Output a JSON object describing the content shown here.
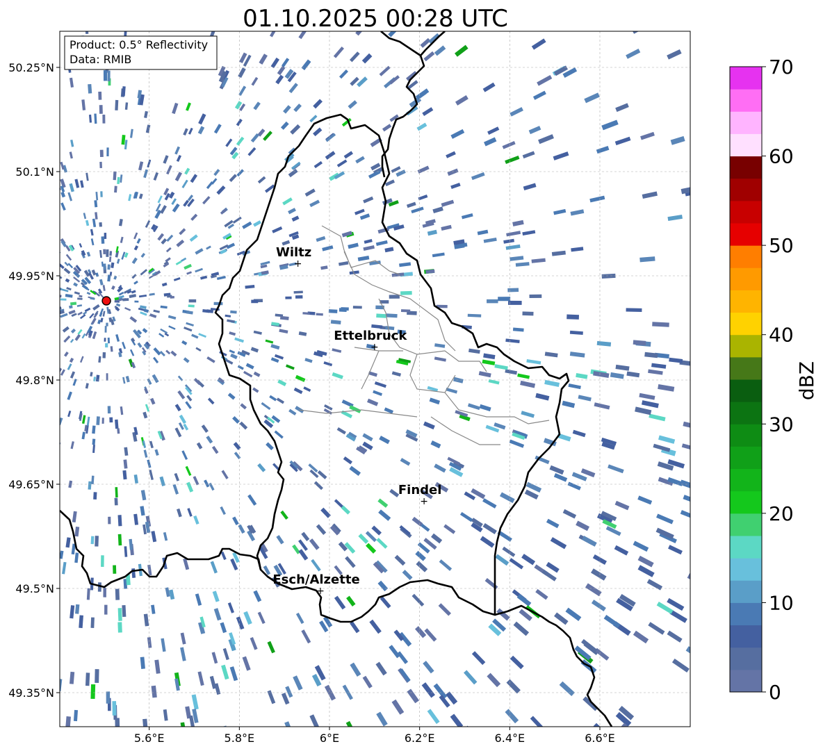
{
  "title": "01.10.2025 00:28 UTC",
  "info_box": {
    "line1": "Product: 0.5° Reflectivity",
    "line2": "Data: RMIB"
  },
  "axes": {
    "lon_ticks": [
      {
        "value": 5.6,
        "label": "5.6°E"
      },
      {
        "value": 5.8,
        "label": "5.8°E"
      },
      {
        "value": 6.0,
        "label": "6°E"
      },
      {
        "value": 6.2,
        "label": "6.2°E"
      },
      {
        "value": 6.4,
        "label": "6.4°E"
      },
      {
        "value": 6.6,
        "label": "6.6°E"
      }
    ],
    "lat_ticks": [
      {
        "value": 50.25,
        "label": "50.25°N"
      },
      {
        "value": 50.1,
        "label": "50.1°N"
      },
      {
        "value": 49.95,
        "label": "49.95°N"
      },
      {
        "value": 49.8,
        "label": "49.8°N"
      },
      {
        "value": 49.65,
        "label": "49.65°N"
      },
      {
        "value": 49.5,
        "label": "49.5°N"
      },
      {
        "value": 49.35,
        "label": "49.35°N"
      }
    ],
    "lon_range": [
      5.4,
      6.8
    ],
    "lat_range": [
      49.3,
      50.3
    ]
  },
  "cities": [
    {
      "name": "Wiltz",
      "lon": 5.93,
      "lat": 49.968
    },
    {
      "name": "Ettelbruck",
      "lon": 6.1,
      "lat": 49.848
    },
    {
      "name": "Findel",
      "lon": 6.21,
      "lat": 49.626
    },
    {
      "name": "Esch/Alzette",
      "lon": 5.98,
      "lat": 49.497
    }
  ],
  "radar_site": {
    "lon": 5.505,
    "lat": 49.914
  },
  "colorbar": {
    "label": "dBZ",
    "min": 0,
    "max": 70,
    "ticks": [
      {
        "value": 0,
        "label": "0"
      },
      {
        "value": 10,
        "label": "10"
      },
      {
        "value": 20,
        "label": "20"
      },
      {
        "value": 30,
        "label": "30"
      },
      {
        "value": 40,
        "label": "40"
      },
      {
        "value": 50,
        "label": "50"
      },
      {
        "value": 60,
        "label": "60"
      },
      {
        "value": 70,
        "label": "70"
      }
    ],
    "colors": [
      "#6474a6",
      "#566ea0",
      "#4460a0",
      "#4a7ab4",
      "#5a9ec8",
      "#68c0dc",
      "#5cd8c4",
      "#40d070",
      "#14c81c",
      "#12b41a",
      "#10a018",
      "#0e8c14",
      "#0c7412",
      "#0a5e10",
      "#467818",
      "#aab400",
      "#ffd200",
      "#ffb400",
      "#ff9a00",
      "#ff7e00",
      "#e60000",
      "#c80000",
      "#a00000",
      "#780000",
      "#ffe0ff",
      "#ffb4ff",
      "#ff6ef4",
      "#e632f0"
    ]
  }
}
